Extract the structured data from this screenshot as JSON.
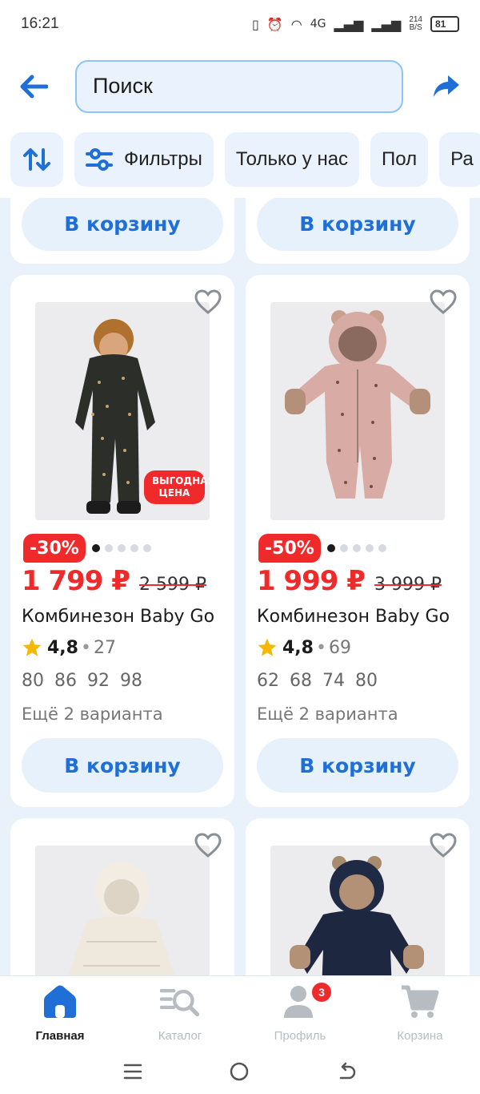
{
  "status_bar": {
    "time": "16:21",
    "network": "4G",
    "rate": "214",
    "rate_unit": "B/S",
    "battery": "81"
  },
  "header": {
    "search_placeholder": "Поиск"
  },
  "chips": [
    {
      "label": "Фильтры"
    },
    {
      "label": "Только у нас"
    },
    {
      "label": "Пол"
    },
    {
      "label": "Ра"
    }
  ],
  "cart_label": "В корзину",
  "products": [
    {
      "discount": "-30%",
      "promo": "ВЫГОДНАЯ ЦЕНА",
      "price": "1 799 ₽",
      "old_price": "2 599 ₽",
      "title": "Комбинезон Baby Go",
      "rating": "4,8",
      "reviews": "27",
      "sizes": "80 86 92 98",
      "variants": "Ещё 2 варианта",
      "image_count": 5,
      "image_index": 1
    },
    {
      "discount": "-50%",
      "price": "1 999 ₽",
      "old_price": "3 999 ₽",
      "title": "Комбинезон Baby Go",
      "rating": "4,8",
      "reviews": "69",
      "sizes": "62 68 74 80",
      "variants": "Ещё 2 варианта",
      "image_count": 5,
      "image_index": 1
    }
  ],
  "bottom_nav": {
    "home": "Главная",
    "catalog": "Каталог",
    "profile": "Профиль",
    "profile_badge": "3",
    "cart": "Корзина"
  },
  "colors": {
    "accent": "#1f6fd6",
    "sale": "#f02a2a",
    "feed_bg": "#e9f2fb",
    "chip_bg": "#eaf3fd"
  }
}
